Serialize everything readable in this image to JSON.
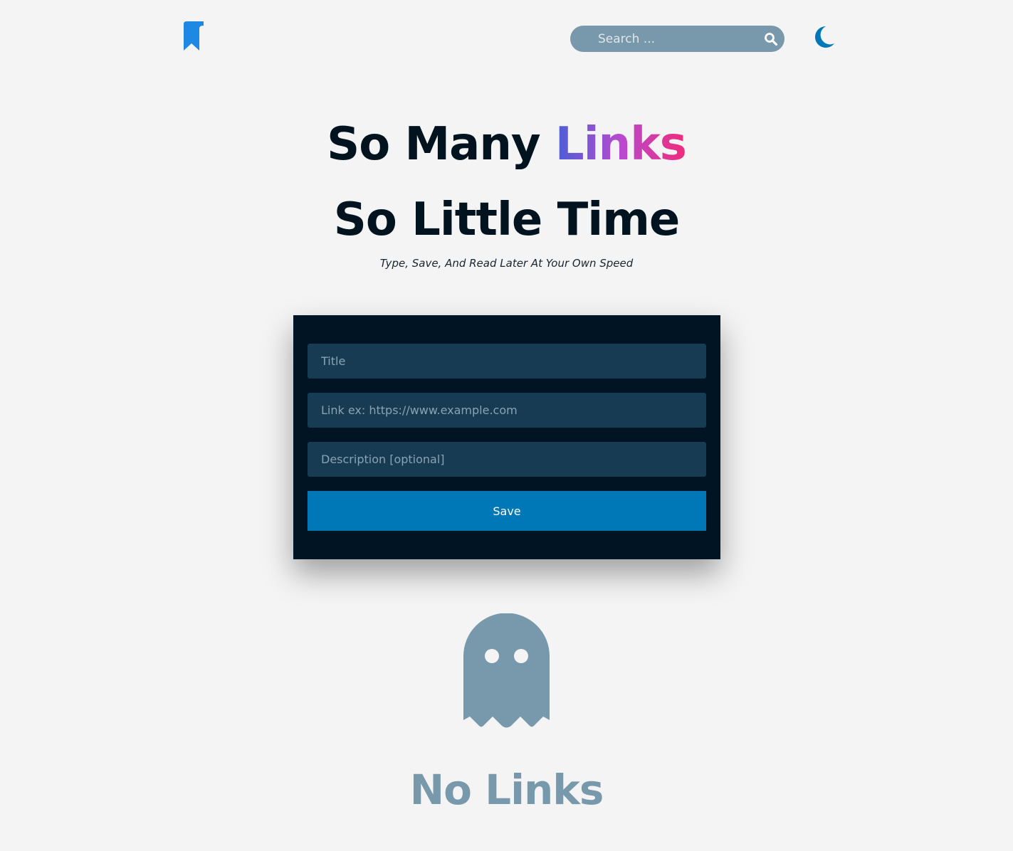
{
  "header": {
    "logo_icon": "bookmark-icon",
    "search": {
      "placeholder": "Search ...",
      "value": "",
      "icon": "search-icon"
    },
    "theme_toggle_icon": "moon-icon"
  },
  "hero": {
    "line1_prefix": "So Many ",
    "line1_highlight": "Links",
    "line2": "So Little Time",
    "tagline": "Type, Save, And Read Later At Your Own Speed"
  },
  "form": {
    "title_placeholder": "Title",
    "link_placeholder": "Link ex: https://www.example.com",
    "description_placeholder": "Description [optional]",
    "save_label": "Save"
  },
  "empty_state": {
    "icon": "ghost-icon",
    "text": "No Links"
  },
  "colors": {
    "background": "#f4f4f4",
    "accent": "#0077b6",
    "card": "#001423",
    "field": "#173b52",
    "muted": "#7898ab",
    "logo": "#1e88e5"
  }
}
